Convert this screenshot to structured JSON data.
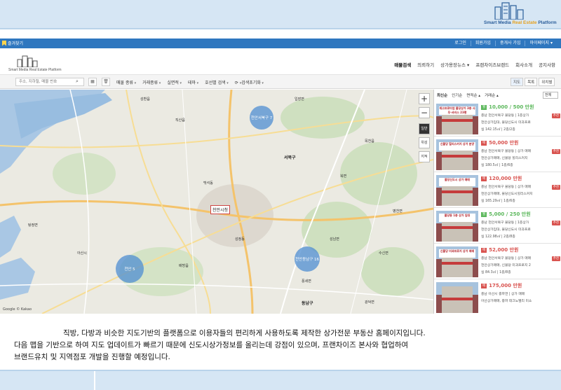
{
  "slide": {
    "brand": {
      "prefix": "Smart Media ",
      "highlight": "Real Estate",
      "suffix": " Platform"
    }
  },
  "topbar": {
    "favorite": "즐겨찾기",
    "links": [
      "로그인",
      "회원가입",
      "중개사 가입",
      "마이페이지 ▾"
    ]
  },
  "header": {
    "logo_text": "Smart Media Real Estate Platform",
    "nav": [
      "매물검색",
      "의뢰하기",
      "상가용장뉴스 ▾",
      "프랜차이즈브랜드",
      "회사소개",
      "공지사항"
    ]
  },
  "filterbar": {
    "search_placeholder": "주소, 지하철, 매물 번호",
    "filters": [
      "매물 종류",
      "거래종류",
      "실면적",
      "테마",
      "호선별 검색"
    ],
    "reset": "검색초기화",
    "view_tabs": [
      "지도",
      "목록",
      "위치별"
    ]
  },
  "map": {
    "clusters": [
      {
        "label": "천안서북구 7"
      },
      {
        "label": "천안 5"
      },
      {
        "label": "천안동남구 16"
      }
    ],
    "labels": [
      "천안시청",
      "서북구",
      "동남구",
      "백석동",
      "성정동",
      "목천읍",
      "병천면",
      "풍세면",
      "광덕면",
      "직산읍",
      "성환읍",
      "입장면",
      "북면",
      "성남면",
      "수신면",
      "아산시",
      "탕정면",
      "배방읍"
    ],
    "city_label": "천안시청",
    "zoom_in": "+",
    "zoom_out": "−",
    "map_types": [
      "일반",
      "위성",
      "지적"
    ],
    "brand": "Google",
    "kakao": "© Kakao"
  },
  "panel": {
    "sorts": [
      "최신순",
      "인기순",
      "면적순 ▴",
      "거래순 ▴"
    ],
    "select": "전체",
    "listings": [
      {
        "tag": "월",
        "tag_color": "#5cb85c",
        "price": "10,000 / 500 만원",
        "price_color": "#5cb85c",
        "addr": "충남 천안서북구 불당동 | 1층상가",
        "desc": "천안상가임대, 불당신도시 미과프로",
        "size": "실 142.15㎡ | 2층/2층",
        "badge": "추천",
        "banner": "재고프로미엄 불당상가 3층 사무·서비스 23평"
      },
      {
        "tag": "매",
        "tag_color": "#d9534f",
        "price": "50,000 만원",
        "price_color": "#d9534f",
        "addr": "충남 천안서북구 불당동 | 상가 매매",
        "desc": "천안상가매매, 신불당 힐리스커지",
        "size": "실 180.5㎡ | 1층/6층",
        "badge": "추천",
        "banner": "신불당 힐리스커지 상가 분양"
      },
      {
        "tag": "매",
        "tag_color": "#d9534f",
        "price": "120,000 만원",
        "price_color": "#d9534f",
        "addr": "충남 천안서북구 불당동 | 상가 매매",
        "desc": "천안상가매매, 불당신도시힐리스커지",
        "size": "실 165.29㎡ | 1층/6층",
        "badge": "추천",
        "banner": "불당신도시 상가 매매"
      },
      {
        "tag": "월",
        "tag_color": "#5cb85c",
        "price": "5,000 / 250 만원",
        "price_color": "#5cb85c",
        "addr": "충남 천안서북구 불당동 | 1층상가",
        "desc": "천안상가임대, 불당신도시 미과프로",
        "size": "실 122.98㎡ | 2층/8층",
        "badge": "추천",
        "banner": "불당동 1층 상가 임대"
      },
      {
        "tag": "매",
        "tag_color": "#d9534f",
        "price": "52,000 만원",
        "price_color": "#d9534f",
        "addr": "충남 천안서북구 불당동 | 상가 매매",
        "desc": "천안상가매매, 신불당 미과프로지 2",
        "size": "실 84.3㎡ | 1층/8층",
        "badge": "추천",
        "banner": "신불당 미과프로지 상가 매매"
      },
      {
        "tag": "매",
        "tag_color": "#d9534f",
        "price": "175,000 만원",
        "price_color": "#d9534f",
        "addr": "충남 아산시 중파면 | 상가 매매",
        "desc": "아산상가매매, 중파 테크노밸리 미소",
        "size": "",
        "badge": "",
        "banner": ""
      }
    ]
  },
  "caption": {
    "line1": "직방, 다방과 비슷한 지도기반의 플랫폼으로 이용자들의 편리하게 사용하도록 제작한 상가전문 부동산 홈페이지입니다.",
    "line2": "다음 맵을 기반으로 하여 지도 업데이트가 빠르기 때문에 신도시상가정보를 올리는데 강점이 있으며, 프랜차이즈 본사와 협업하여",
    "line3": "브랜드유치 및 지역점포 개발을 진행할 예정입니다."
  }
}
